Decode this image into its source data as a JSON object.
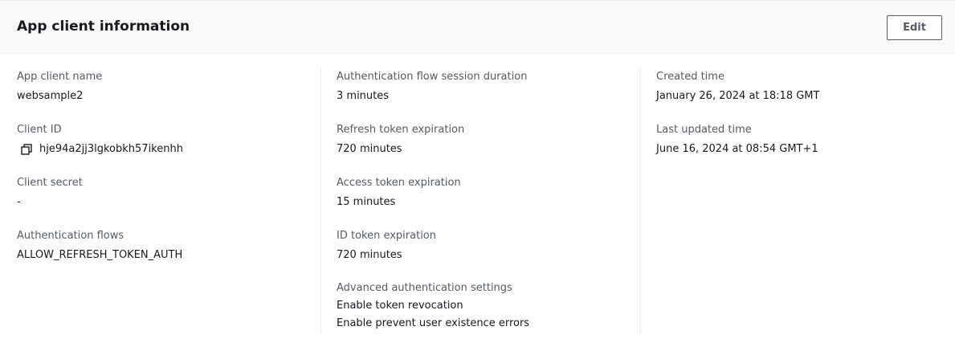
{
  "panel": {
    "title": "App client information",
    "edit_label": "Edit"
  },
  "column1": {
    "app_client_name": {
      "label": "App client name",
      "value": "websample2"
    },
    "client_id": {
      "label": "Client ID",
      "value": "hje94a2jj3lgkobkh57ikenhh",
      "icon": "copy-icon"
    },
    "client_secret": {
      "label": "Client secret",
      "value": "-"
    },
    "auth_flows": {
      "label": "Authentication flows",
      "value": "ALLOW_REFRESH_TOKEN_AUTH"
    }
  },
  "column2": {
    "session_duration": {
      "label": "Authentication flow session duration",
      "value": "3 minutes"
    },
    "refresh_token": {
      "label": "Refresh token expiration",
      "value": "720 minutes"
    },
    "access_token": {
      "label": "Access token expiration",
      "value": "15 minutes"
    },
    "id_token": {
      "label": "ID token expiration",
      "value": "720 minutes"
    },
    "advanced": {
      "label": "Advanced authentication settings",
      "values": [
        "Enable token revocation",
        "Enable prevent user existence errors"
      ]
    }
  },
  "column3": {
    "created": {
      "label": "Created time",
      "value": "January 26, 2024 at 18:18 GMT"
    },
    "updated": {
      "label": "Last updated time",
      "value": "June 16, 2024 at 08:54 GMT+1"
    }
  }
}
